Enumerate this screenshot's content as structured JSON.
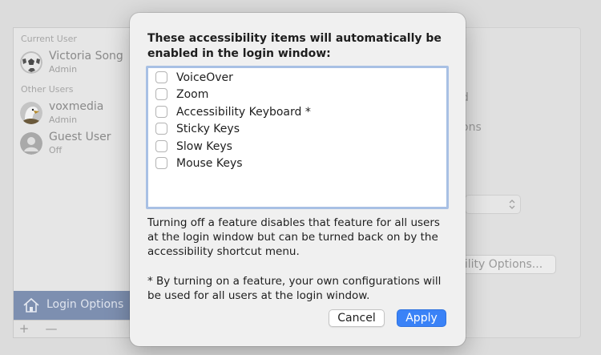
{
  "sidebar": {
    "current_user_label": "Current User",
    "other_users_label": "Other Users",
    "users": [
      {
        "name": "Victoria Song",
        "role": "Admin",
        "avatar": "soccer-ball-avatar"
      },
      {
        "name": "voxmedia",
        "role": "Admin",
        "avatar": "eagle-avatar"
      },
      {
        "name": "Guest User",
        "role": "Off",
        "avatar": "generic-person-avatar"
      }
    ],
    "login_options_label": "Login Options",
    "add_symbol": "+",
    "remove_symbol": "—"
  },
  "background": {
    "frag_1": "d",
    "frag_2": "ons",
    "options_button": "bility Options..."
  },
  "dialog": {
    "heading": "These accessibility items will automatically be enabled in the login window:",
    "features": [
      {
        "label": "VoiceOver",
        "checked": false
      },
      {
        "label": "Zoom",
        "checked": false
      },
      {
        "label": "Accessibility Keyboard *",
        "checked": false
      },
      {
        "label": "Sticky Keys",
        "checked": false
      },
      {
        "label": "Slow Keys",
        "checked": false
      },
      {
        "label": "Mouse Keys",
        "checked": false
      }
    ],
    "note_1": "Turning off a feature disables that feature for all users at the login window but can be turned back on by the accessibility shortcut menu.",
    "note_2": "* By turning on a feature, your own configurations will be used for all users at the login window.",
    "cancel_label": "Cancel",
    "apply_label": "Apply"
  },
  "colors": {
    "accent": "#3a82f7",
    "sidebar_selected": "#7d8fb0",
    "list_focus_ring": "#a8c0e4"
  }
}
